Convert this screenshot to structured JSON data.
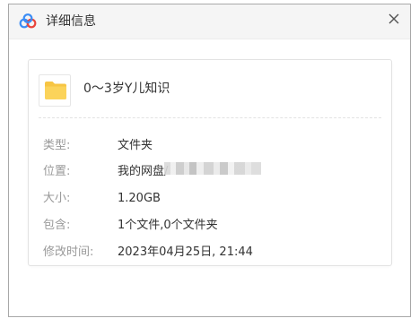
{
  "dialog": {
    "title": "详细信息",
    "app_icon": "baidu-netdisk-logo-icon",
    "close_icon": "close-icon",
    "close_glyph": "✕"
  },
  "file": {
    "icon": "folder-icon",
    "name": "0～3岁Y儿知识"
  },
  "properties": {
    "type": {
      "label": "类型:",
      "value": "文件夹"
    },
    "location": {
      "label": "位置:",
      "value": "我的网盘/"
    },
    "size": {
      "label": "大小:",
      "value": "1.20GB"
    },
    "contains": {
      "label": "包含:",
      "value": "1个文件,0个文件夹"
    },
    "modified": {
      "label": "修改时间:",
      "value": "2023年04月25日, 21:44"
    }
  },
  "colors": {
    "folder_yellow": "#f7c543",
    "logo_blue": "#3b8cf5",
    "label_gray": "#999999",
    "text_dark": "#333333"
  }
}
